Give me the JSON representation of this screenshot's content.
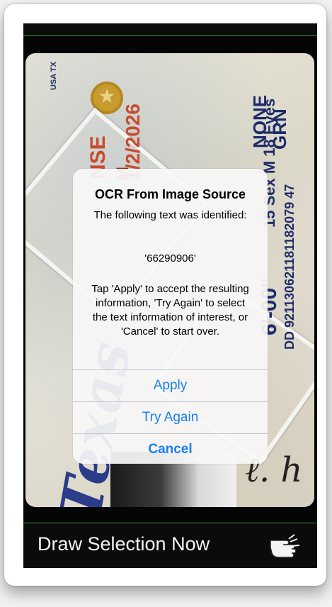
{
  "license": {
    "country_state": "USA TX",
    "nse_text": "NSE",
    "m_text": "M",
    "date_text": "1/2/2026",
    "none_text": "NONE",
    "grn_text": "GRN",
    "height_text": "6'-00\"",
    "sex_text": "15 Sex M  18 Eyes",
    "dd_text": "DD 921130621181182079 47",
    "texas_text": "Texas"
  },
  "dialog": {
    "title": "OCR From Image Source",
    "subtitle": "The following text was identified:",
    "value": "'66290906'",
    "description": "Tap 'Apply' to accept the resulting information, 'Try Again' to select the text information of interest, or 'Cancel' to start over.",
    "buttons": {
      "apply": "Apply",
      "try_again": "Try Again",
      "cancel": "Cancel"
    },
    "button_color": "#1a7ef0"
  },
  "bottom_bar": {
    "label": "Draw Selection Now",
    "icon": "pointing-hand-icon"
  }
}
